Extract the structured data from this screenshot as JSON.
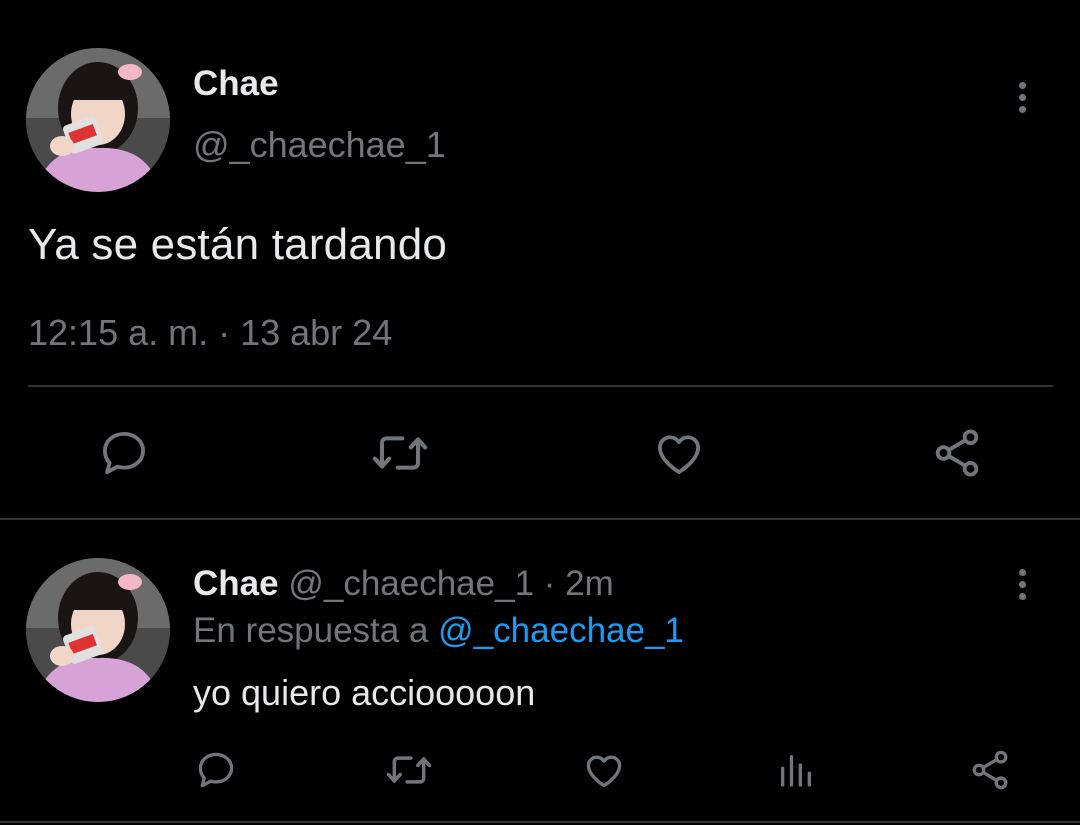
{
  "colors": {
    "background": "#000000",
    "text_primary": "#e7e9ea",
    "text_secondary": "#71767b",
    "link": "#1d9bf0",
    "divider": "#2f3336"
  },
  "main_tweet": {
    "display_name": "Chae",
    "handle": "@_chaechae_1",
    "text": "Ya se están tardando",
    "meta": "12:15 a. m. · 13 abr 24",
    "actions": [
      "reply-icon",
      "retweet-icon",
      "like-icon",
      "share-icon"
    ]
  },
  "reply_tweet": {
    "display_name": "Chae",
    "handle": "@_chaechae_1",
    "separator": "·",
    "time": "2m",
    "replying_to_label": "En respuesta a",
    "replying_to_mention": "@_chaechae_1",
    "text": "yo quiero acciooooon",
    "actions": [
      "reply-icon",
      "retweet-icon",
      "like-icon",
      "views-icon",
      "share-icon"
    ]
  }
}
